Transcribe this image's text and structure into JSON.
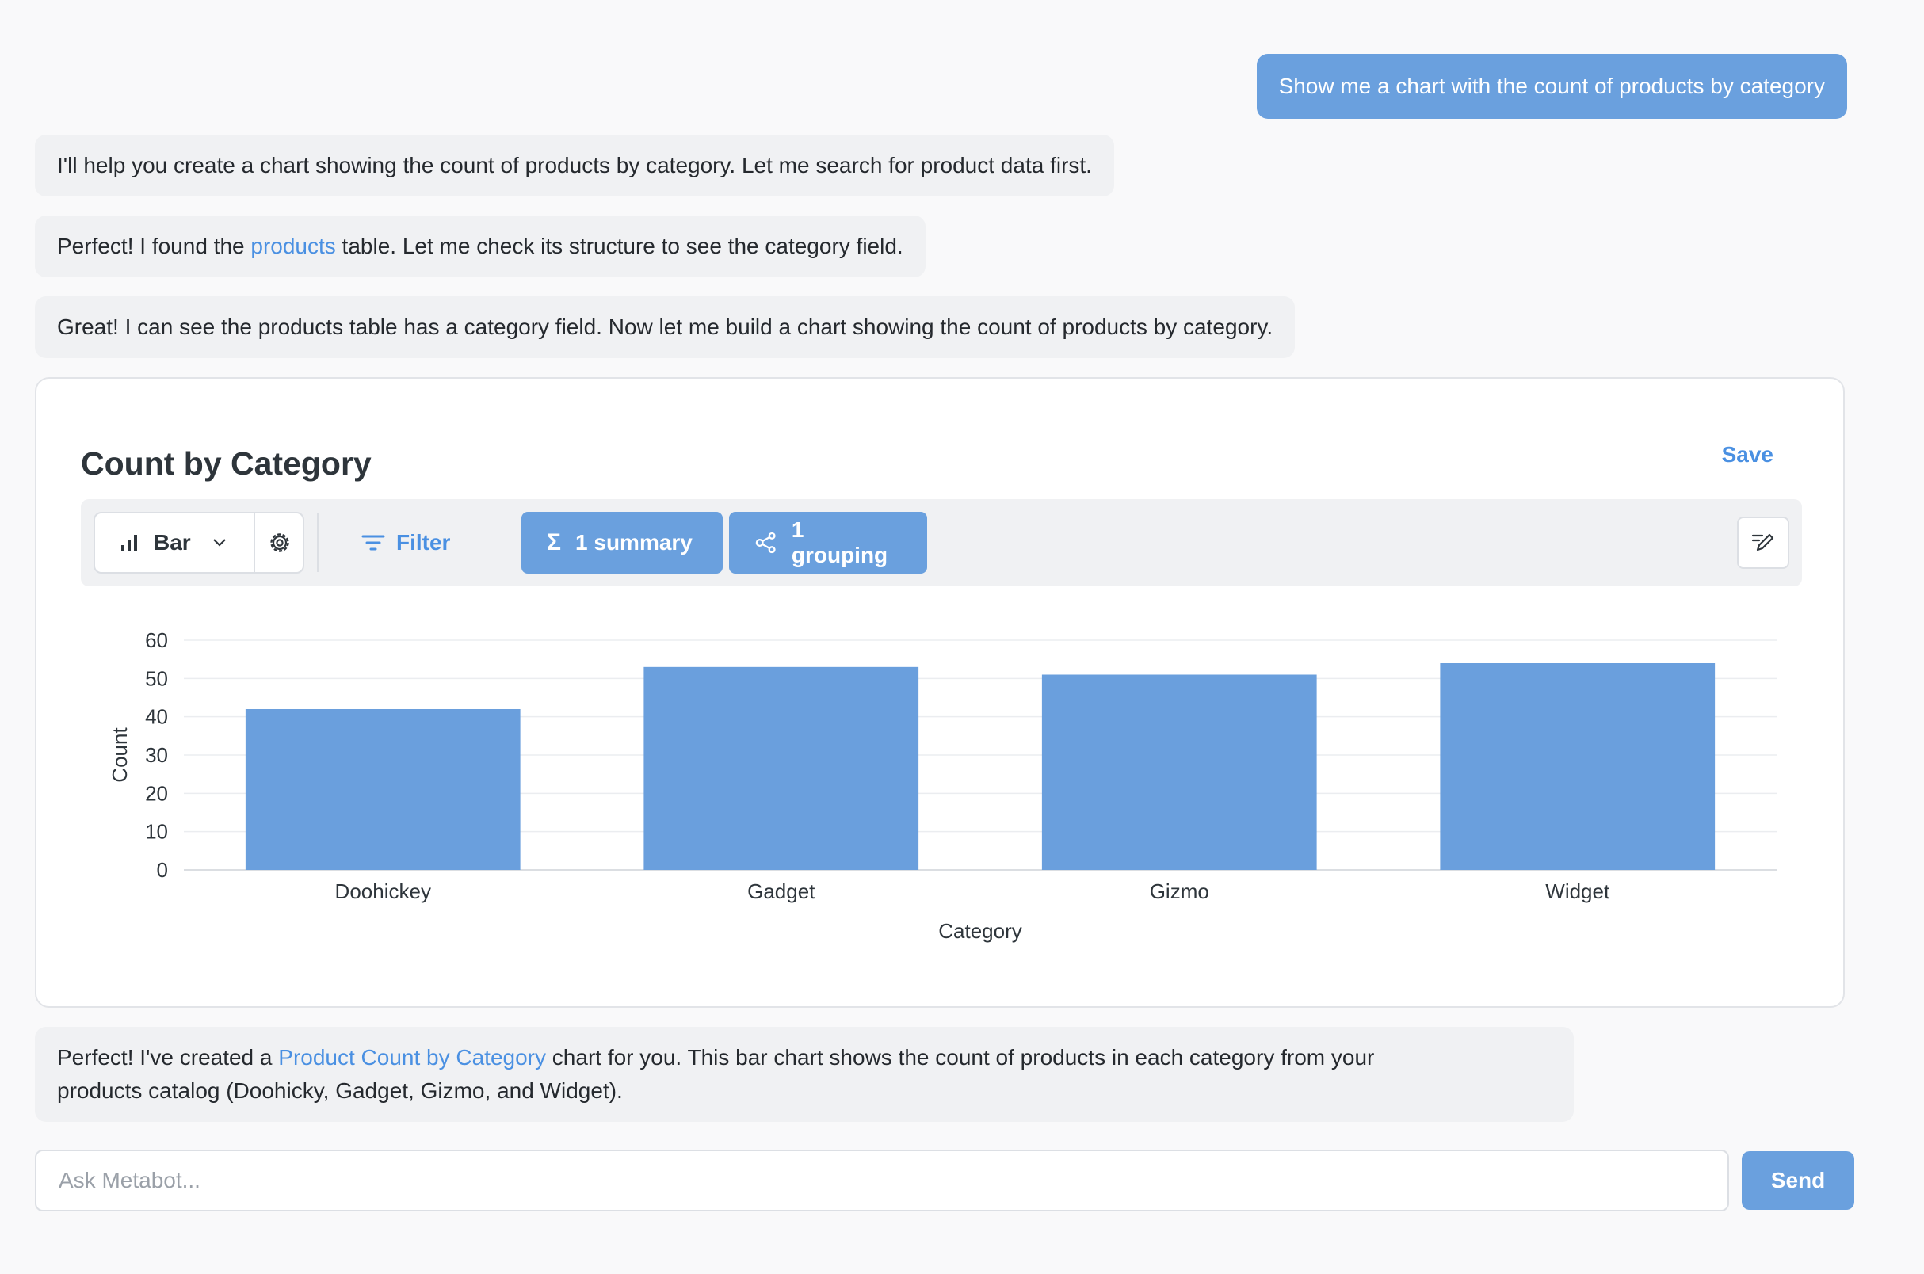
{
  "conversation": {
    "user_message": "Show me a chart with the count of products by category",
    "bot_message_1": "I'll help you create a chart showing the count of products by category. Let me search for product data first.",
    "bot_message_2": {
      "prefix": "Perfect! I found the ",
      "link": "products",
      "suffix": " table. Let me check its structure to see the category field."
    },
    "bot_message_3": "Great! I can see the products table has a category field. Now let me build a chart showing the count of products by category.",
    "bot_message_4": {
      "prefix": "Perfect! I've created a ",
      "link": "Product Count by Category",
      "suffix_line1": " chart for you. This bar chart shows the count of products in each category from your",
      "line2": "products catalog (Doohicky, Gadget, Gizmo, and Widget)."
    }
  },
  "chart_card": {
    "title": "Count by Category",
    "save_label": "Save",
    "toolbar": {
      "chart_type_label": "Bar",
      "filter_label": "Filter",
      "summary_label": "1 summary",
      "grouping_label": "1 grouping"
    }
  },
  "chart_data": {
    "type": "bar",
    "categories": [
      "Doohickey",
      "Gadget",
      "Gizmo",
      "Widget"
    ],
    "values": [
      42,
      53,
      51,
      54
    ],
    "title": "Count by Category",
    "xlabel": "Category",
    "ylabel": "Count",
    "ylim": [
      0,
      60
    ],
    "yticks": [
      0,
      10,
      20,
      30,
      40,
      50,
      60
    ],
    "grid": true,
    "color": "#6a9fdd"
  },
  "composer": {
    "placeholder": "Ask Metabot...",
    "send_label": "Send"
  },
  "colors": {
    "accent": "#6aa0de",
    "link": "#4a90e2",
    "background": "#f9f9fa"
  }
}
